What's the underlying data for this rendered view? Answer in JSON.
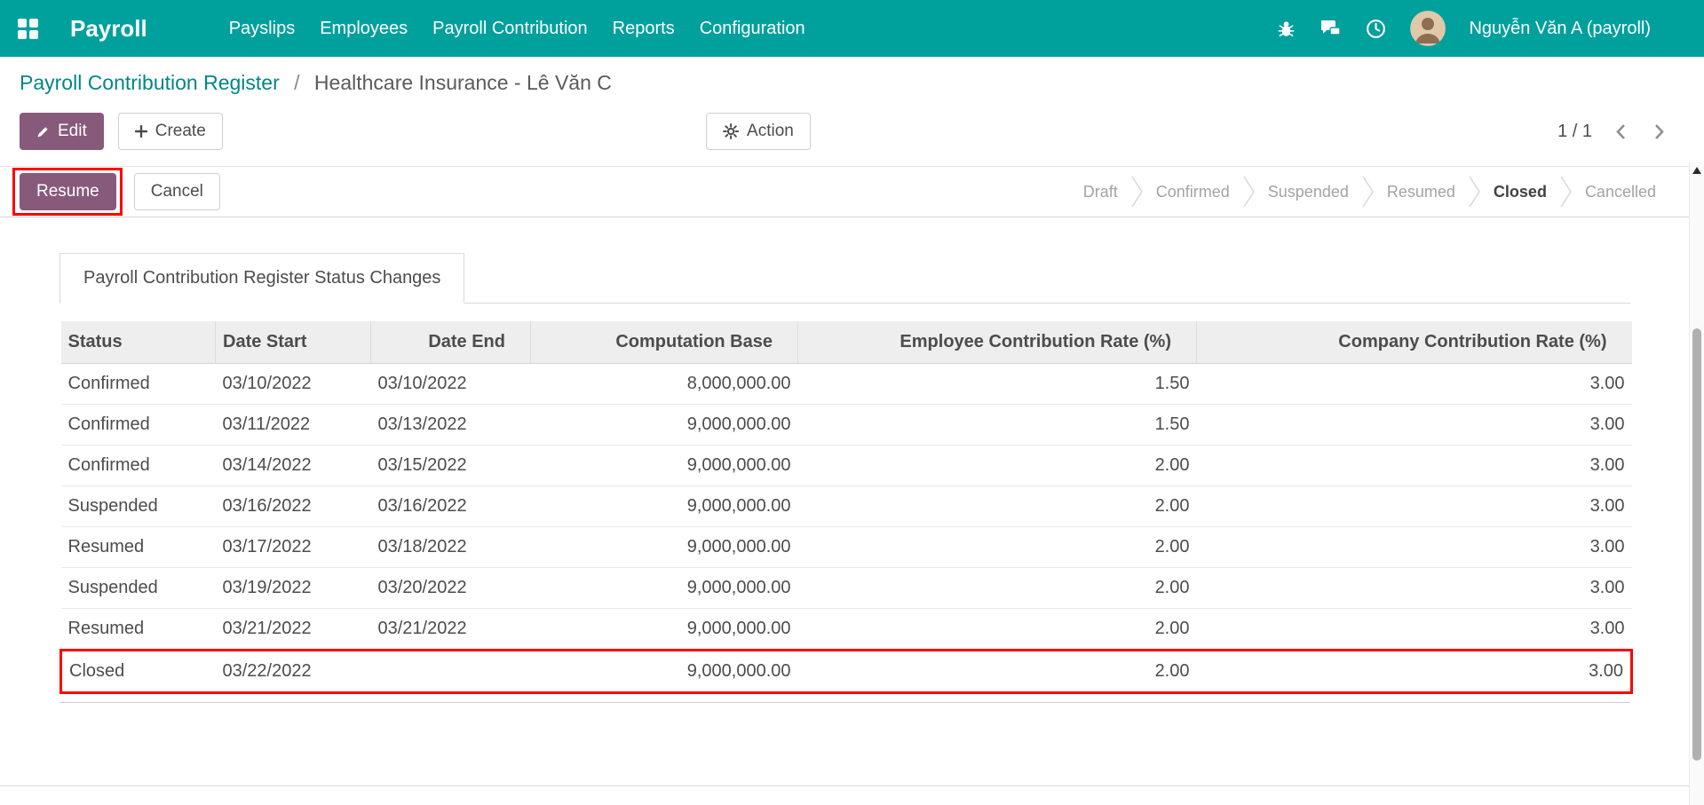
{
  "colors": {
    "navbar_bg": "#00a09d",
    "accent": "#875a7b",
    "link": "#008784",
    "annotation": "#ff0000",
    "table_header_bg": "#eeeeee"
  },
  "navbar": {
    "brand": "Payroll",
    "menu": [
      "Payslips",
      "Employees",
      "Payroll Contribution",
      "Reports",
      "Configuration"
    ],
    "user": "Nguyễn Văn A (payroll)"
  },
  "breadcrumb": {
    "parent": "Payroll Contribution Register",
    "separator": "/",
    "current": "Healthcare Insurance - Lê Văn C"
  },
  "toolbar": {
    "edit": "Edit",
    "create": "Create",
    "action": "Action",
    "pager": "1 / 1"
  },
  "statusbar": {
    "resume": "Resume",
    "cancel": "Cancel",
    "states": [
      {
        "label": "Draft",
        "active": false
      },
      {
        "label": "Confirmed",
        "active": false
      },
      {
        "label": "Suspended",
        "active": false
      },
      {
        "label": "Resumed",
        "active": false
      },
      {
        "label": "Closed",
        "active": true
      },
      {
        "label": "Cancelled",
        "active": false
      }
    ]
  },
  "notebook": {
    "tab": "Payroll Contribution Register Status Changes"
  },
  "table": {
    "headers": [
      "Status",
      "Date Start",
      "Date End",
      "Computation Base",
      "Employee Contribution Rate (%)",
      "Company Contribution Rate (%)"
    ],
    "rows": [
      [
        "Confirmed",
        "03/10/2022",
        "03/10/2022",
        "8,000,000.00",
        "1.50",
        "3.00"
      ],
      [
        "Confirmed",
        "03/11/2022",
        "03/13/2022",
        "9,000,000.00",
        "1.50",
        "3.00"
      ],
      [
        "Confirmed",
        "03/14/2022",
        "03/15/2022",
        "9,000,000.00",
        "2.00",
        "3.00"
      ],
      [
        "Suspended",
        "03/16/2022",
        "03/16/2022",
        "9,000,000.00",
        "2.00",
        "3.00"
      ],
      [
        "Resumed",
        "03/17/2022",
        "03/18/2022",
        "9,000,000.00",
        "2.00",
        "3.00"
      ],
      [
        "Suspended",
        "03/19/2022",
        "03/20/2022",
        "9,000,000.00",
        "2.00",
        "3.00"
      ],
      [
        "Resumed",
        "03/21/2022",
        "03/21/2022",
        "9,000,000.00",
        "2.00",
        "3.00"
      ],
      [
        "Closed",
        "03/22/2022",
        "",
        "9,000,000.00",
        "2.00",
        "3.00"
      ]
    ],
    "highlight_row": 7
  }
}
